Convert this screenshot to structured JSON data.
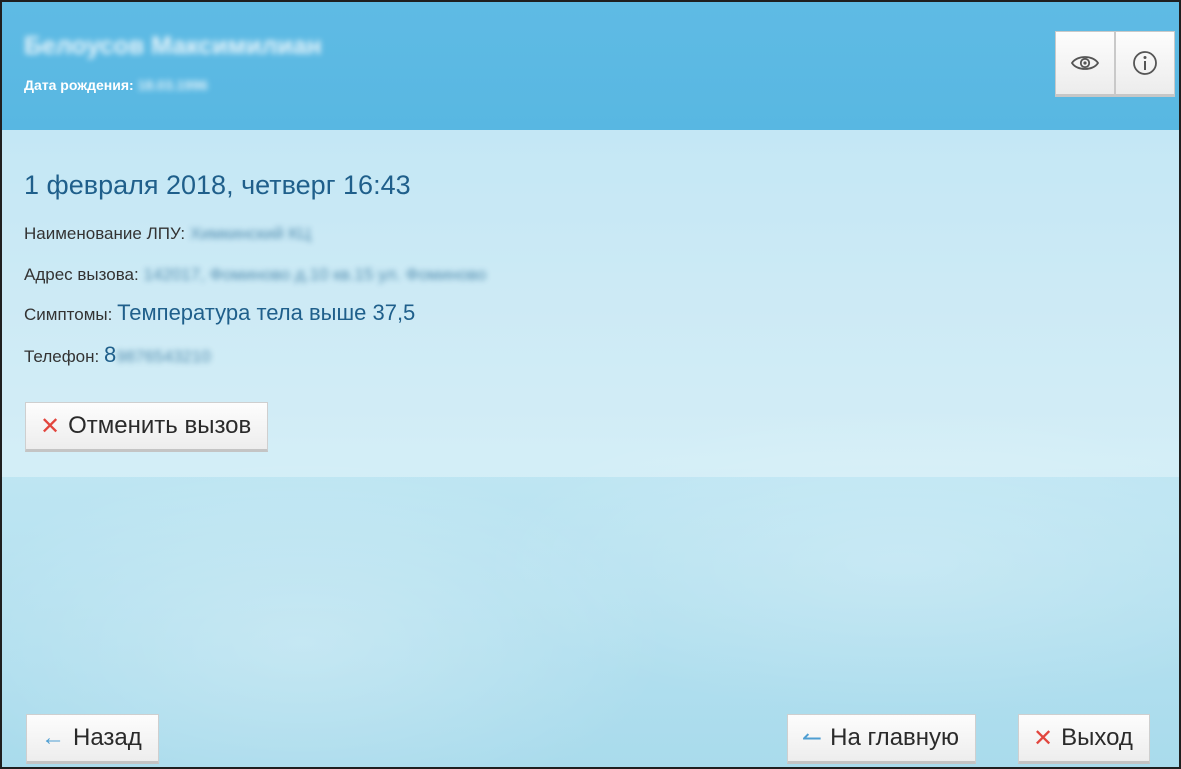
{
  "header": {
    "patient_name": "Белоусов Максимилиан",
    "birth_label": "Дата рождения:",
    "birth_value": "18.03.1996",
    "eye_icon": "eye-icon",
    "info_icon": "info-icon"
  },
  "call": {
    "datetime": "1 февраля 2018, четверг 16:43",
    "lpu_label": "Наименование ЛПУ:",
    "lpu_value": "Химкинский КЦ",
    "address_label": "Адрес вызова:",
    "address_value": "142017, Фоминово д.10 кв.15 ул. Фоминово",
    "symptoms_label": "Симптомы:",
    "symptoms_value": "Температура тела выше 37,5",
    "phone_label": "Телефон:",
    "phone_prefix": "8",
    "phone_value": "9876543210"
  },
  "actions": {
    "cancel_call": "Отменить вызов",
    "back": "Назад",
    "home": "На главную",
    "exit": "Выход"
  },
  "colors": {
    "header_bg": "#5fbbe4",
    "title_text": "#1f5f8b",
    "cancel_icon": "#e2463e",
    "arrow_icon": "#4e9ed2"
  }
}
